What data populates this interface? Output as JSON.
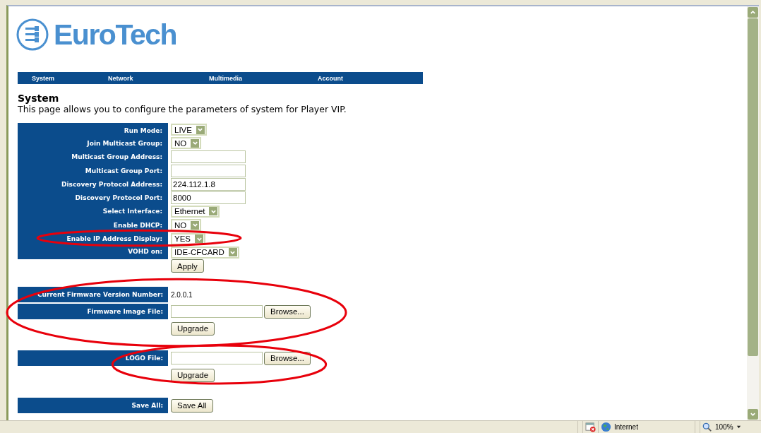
{
  "logo": {
    "text": "EuroTech"
  },
  "nav": [
    {
      "label": "System"
    },
    {
      "label": "Network"
    },
    {
      "label": "Multimedia"
    },
    {
      "label": "Account"
    }
  ],
  "heading": "System",
  "description": "This page allows you to configure the parameters of system for Player VIP.",
  "settings": [
    {
      "label": "Run Mode:",
      "kind": "select",
      "value": "LIVE",
      "highlighted": false
    },
    {
      "label": "Join Multicast Group:",
      "kind": "select",
      "value": "NO",
      "highlighted": false
    },
    {
      "label": "Multicast Group Address:",
      "kind": "input",
      "highlighted": false
    },
    {
      "label": "Multicast Group Port:",
      "kind": "input",
      "highlighted": false
    },
    {
      "label": "Discovery Protocol Address:",
      "kind": "input",
      "value": "224.112.1.8",
      "highlighted": false
    },
    {
      "label": "Discovery Protocol Port:",
      "kind": "input",
      "value": "8000",
      "highlighted": false
    },
    {
      "label": "Select Interface:",
      "kind": "select",
      "value": "Ethernet",
      "highlighted": false
    },
    {
      "label": "Enable DHCP:",
      "kind": "select",
      "value": "NO",
      "highlighted": false
    },
    {
      "label": "Enable IP Address Display:",
      "kind": "select",
      "value": "YES",
      "highlighted": true
    },
    {
      "label": "VOHD on:",
      "kind": "select",
      "value": "IDE-CFCARD",
      "highlighted": false
    }
  ],
  "apply_button": "Apply",
  "firmware": {
    "highlighted": true,
    "action": "Upgrade",
    "rows": [
      {
        "label": "Current Firmware Version Number:",
        "kind": "text",
        "value": "2.0.0.1"
      },
      {
        "label": "Firmware Image File:",
        "kind": "file",
        "button": "Browse..."
      }
    ]
  },
  "logo_upload": {
    "highlighted": true,
    "action": "Upgrade",
    "rows": [
      {
        "label": "LOGO File:",
        "kind": "file",
        "button": "Browse..."
      }
    ]
  },
  "save": {
    "label": "Save All:",
    "button": "Save All"
  },
  "status_bar": {
    "zone": "Internet",
    "zoom": "100%"
  }
}
